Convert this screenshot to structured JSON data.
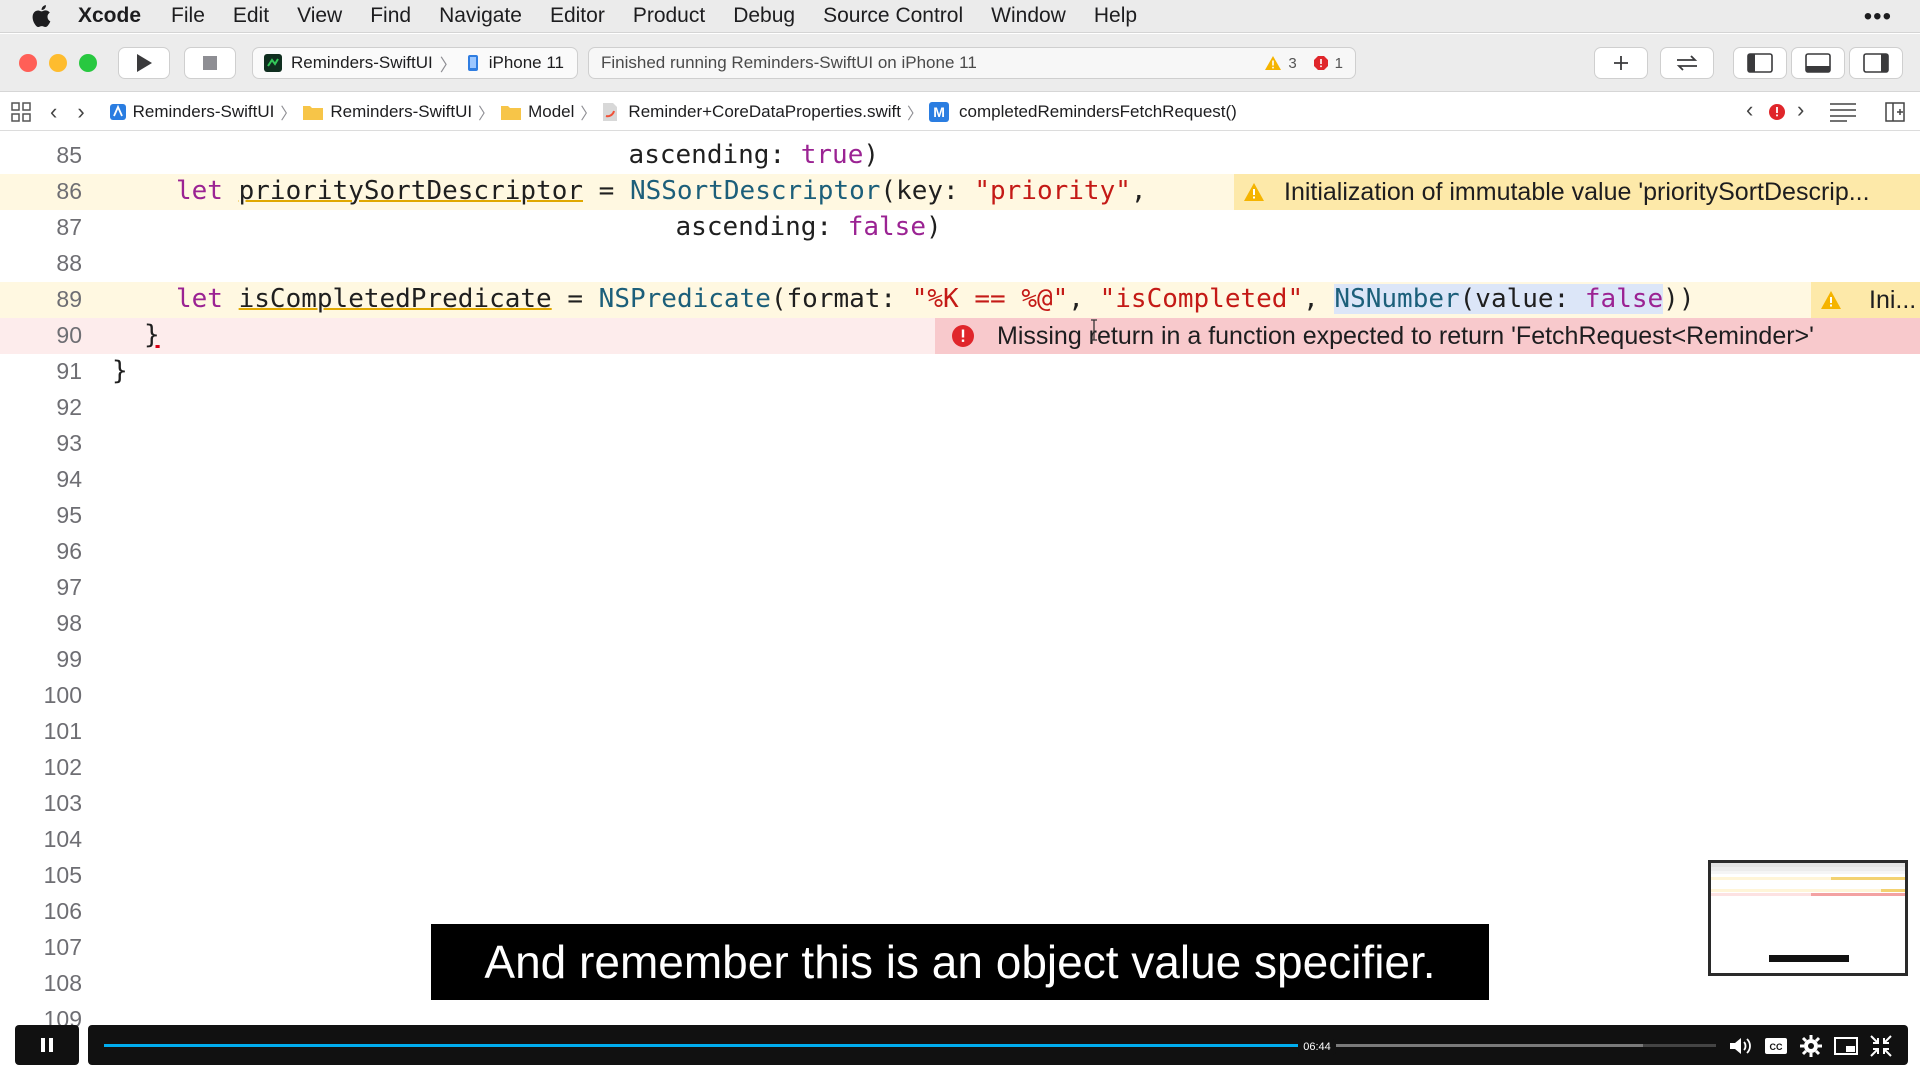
{
  "menubar": {
    "app_name": "Xcode",
    "items": [
      "File",
      "Edit",
      "View",
      "Find",
      "Navigate",
      "Editor",
      "Product",
      "Debug",
      "Source Control",
      "Window",
      "Help"
    ],
    "more": "•••"
  },
  "toolbar": {
    "scheme": "Reminders-SwiftUI",
    "destination": "iPhone 11",
    "activity_status": "Finished running Reminders-SwiftUI on iPhone 11",
    "warning_count": "3",
    "error_count": "1",
    "colors": {
      "close": "#ff5f57",
      "minimize": "#febc2e",
      "zoom": "#28c840"
    }
  },
  "jumpbar": {
    "crumbs": [
      "Reminders-SwiftUI",
      "Reminders-SwiftUI",
      "Model",
      "Reminder+CoreDataProperties.swift",
      "completedRemindersFetchRequest()"
    ],
    "method_badge": "M"
  },
  "editor": {
    "lines": [
      {
        "n": "85"
      },
      {
        "n": "86"
      },
      {
        "n": "87"
      },
      {
        "n": "88"
      },
      {
        "n": "89"
      },
      {
        "n": "90"
      },
      {
        "n": "91"
      },
      {
        "n": "92"
      },
      {
        "n": "93"
      },
      {
        "n": "94"
      },
      {
        "n": "95"
      },
      {
        "n": "96"
      },
      {
        "n": "97"
      },
      {
        "n": "98"
      },
      {
        "n": "99"
      },
      {
        "n": "100"
      },
      {
        "n": "101"
      },
      {
        "n": "102"
      },
      {
        "n": "103"
      },
      {
        "n": "104"
      },
      {
        "n": "105"
      },
      {
        "n": "106"
      },
      {
        "n": "107"
      },
      {
        "n": "108"
      },
      {
        "n": "109"
      }
    ],
    "line85": {
      "pre": "                                 ascending: ",
      "lit": "true",
      "post": ")"
    },
    "line86": {
      "kw": "let",
      "name": "prioritySortDescriptor",
      "eq": " = ",
      "type": "NSSortDescriptor",
      "args": "(key: ",
      "str": "\"priority\"",
      "post": ","
    },
    "line87": {
      "pre": "                                    ascending: ",
      "lit": "false",
      "post": ")"
    },
    "line89": {
      "kw": "let",
      "name": "isCompletedPredicate",
      "eq": " = ",
      "type": "NSPredicate",
      "args": "(format: ",
      "str1": "\"%K == %@\"",
      "comma": ", ",
      "str2": "\"isCompleted\"",
      "comma2": ", ",
      "type2": "NSNumber",
      "args2": "(value: ",
      "lit": "false",
      "post": "))"
    },
    "line90": {
      "text": "}"
    },
    "line91": {
      "text": "}"
    },
    "issues": {
      "warning_86": "Initialization of immutable value 'prioritySortDescrip...",
      "warning_89": "Ini...",
      "error_90": "Missing return in a function expected to return 'FetchRequest<Reminder>'"
    }
  },
  "video": {
    "caption": "And remember this is an object value specifier.",
    "timestamp": "06:44",
    "progress": 0.752,
    "buffered": 0.955
  }
}
